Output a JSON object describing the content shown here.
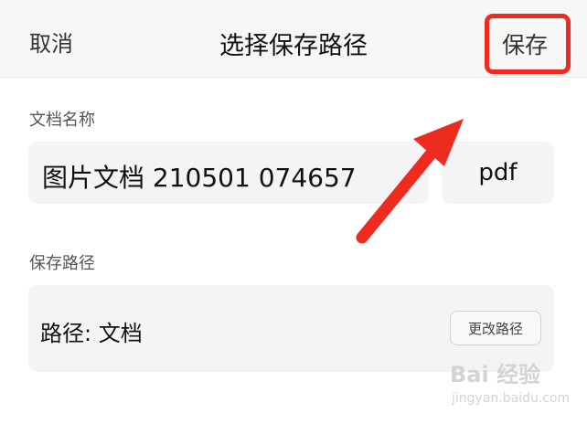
{
  "header": {
    "cancel_label": "取消",
    "title": "选择保存路径",
    "save_label": "保存"
  },
  "document_name": {
    "section_label": "文档名称",
    "value": "图片文档 210501 074657",
    "extension": "pdf"
  },
  "save_path": {
    "section_label": "保存路径",
    "value": "路径: 文档",
    "change_button_label": "更改路径"
  },
  "watermark": {
    "top": "Bai 经验",
    "bottom": "jingyan.baidu.com"
  },
  "colors": {
    "highlight": "#ee2b1f",
    "field_background": "#f4f3f6",
    "header_background": "#f7f7f7"
  }
}
